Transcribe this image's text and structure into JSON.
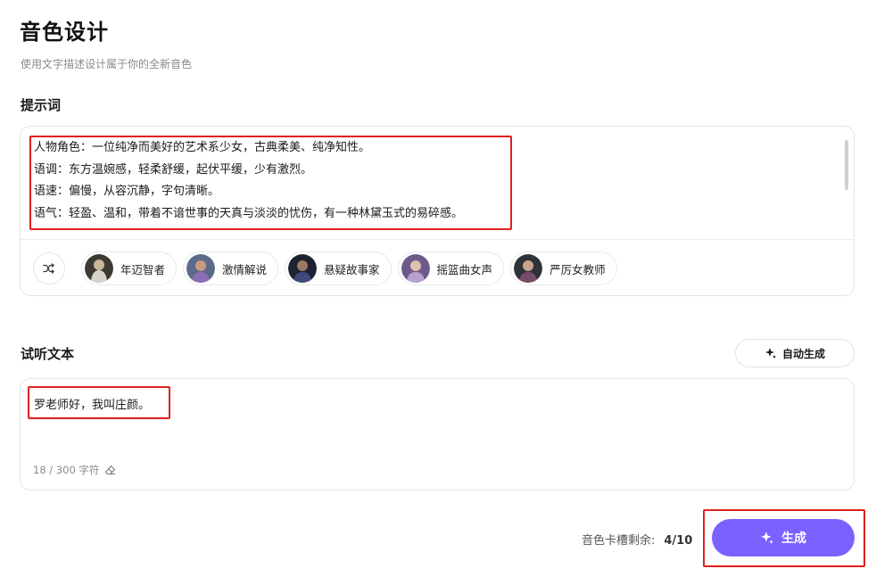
{
  "page": {
    "title": "音色设计",
    "subtitle": "使用文字描述设计属于你的全新音色"
  },
  "prompt": {
    "label": "提示词",
    "lines": [
      "人物角色：一位纯净而美好的艺术系少女，古典柔美、纯净知性。",
      "语调：东方温婉感，轻柔舒缓，起伏平缓，少有激烈。",
      "语速：偏慢，从容沉静，字句清晰。",
      "语气：轻盈、温和，带着不谙世事的天真与淡淡的忧伤，有一种林黛玉式的易碎感。"
    ],
    "presets": [
      {
        "label": "年迈智者",
        "color": "#5a5040"
      },
      {
        "label": "激情解说",
        "color": "#4a5570"
      },
      {
        "label": "悬疑故事家",
        "color": "#2c3040"
      },
      {
        "label": "摇篮曲女声",
        "color": "#6a5a80"
      },
      {
        "label": "严厉女教师",
        "color": "#3a4048"
      }
    ]
  },
  "preview": {
    "label": "试听文本",
    "auto_label": "自动生成",
    "text": "罗老师好，我叫庄颜。",
    "count": "18 / 300 字符"
  },
  "footer": {
    "slots_label": "音色卡槽剩余:",
    "slots_value": "4/10",
    "generate_label": "生成"
  },
  "colors": {
    "accent": "#7b61ff",
    "highlight": "#e02020"
  },
  "icons": [
    "shuffle-icon",
    "sparkle-icon",
    "eraser-icon"
  ]
}
